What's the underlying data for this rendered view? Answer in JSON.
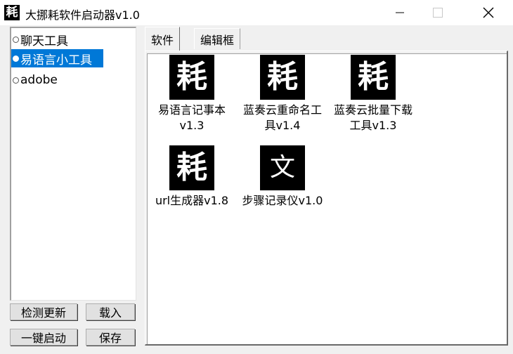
{
  "window": {
    "title": "大挪耗软件启动器v1.0",
    "icon_glyph": "耗",
    "controls": [
      "minimize-icon",
      "maximize-icon",
      "close-icon"
    ]
  },
  "groups": [
    {
      "label": "聊天工具",
      "selected": false
    },
    {
      "label": "易语言小工具",
      "selected": true
    },
    {
      "label": "adobe",
      "selected": false
    }
  ],
  "buttons": {
    "check_update": "检测更新",
    "load": "载入",
    "one_click_start": "一键启动",
    "save": "保存"
  },
  "tabs": [
    {
      "label": "软件",
      "active": true
    },
    {
      "label": "编辑框",
      "active": false
    }
  ],
  "apps": [
    {
      "name": "易语言记事本v1.3",
      "icon_glyph": "耗"
    },
    {
      "name": "蓝奏云重命名工具v1.4",
      "icon_glyph": "耗"
    },
    {
      "name": "蓝奏云批量下载工具v1.3",
      "icon_glyph": "耗"
    },
    {
      "name": "url生成器v1.8",
      "icon_glyph": "耗"
    },
    {
      "name": "步骤记录仪v1.0",
      "icon_glyph": "文"
    }
  ],
  "colors": {
    "selection": "#0078d7",
    "window_bg": "#f0f0f0",
    "titlebar_bg": "#ffffff"
  }
}
